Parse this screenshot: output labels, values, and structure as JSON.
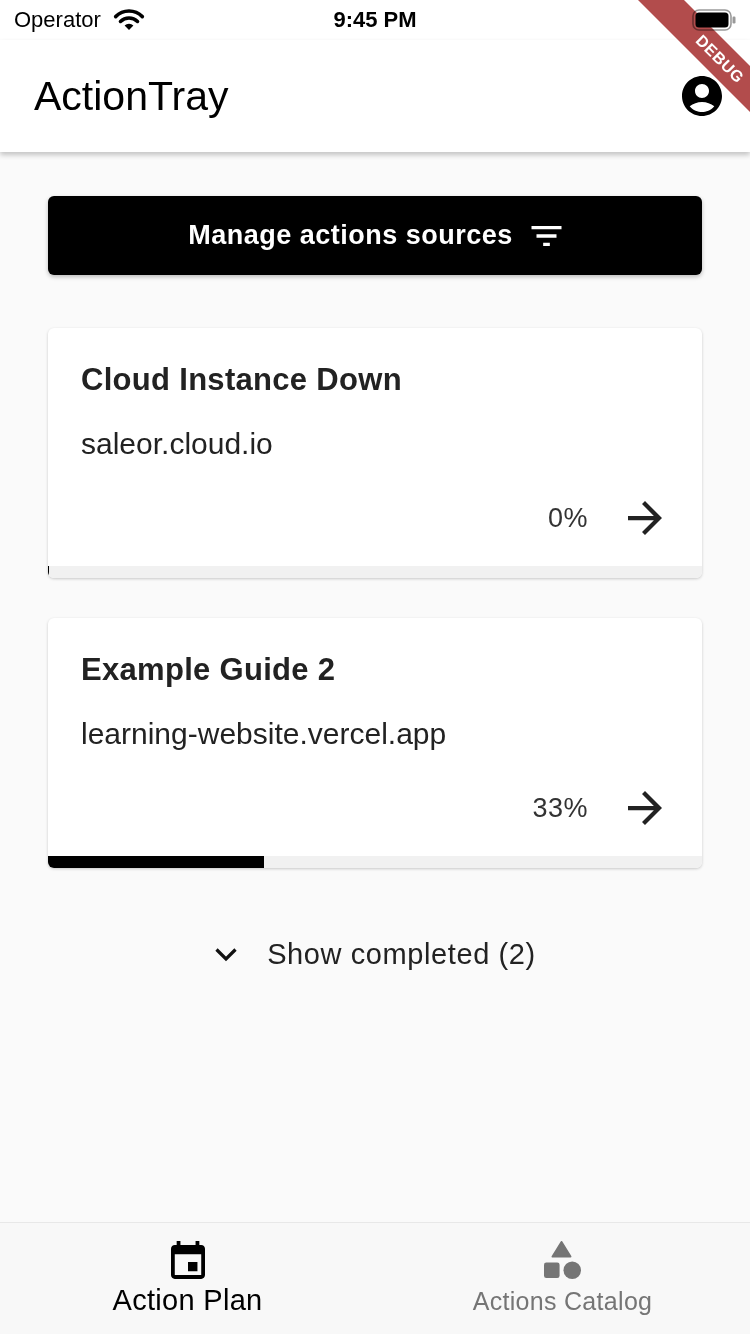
{
  "status_bar": {
    "carrier": "Operator",
    "time": "9:45 PM"
  },
  "debug_banner": {
    "label": "DEBUG"
  },
  "app_bar": {
    "title": "ActionTray"
  },
  "manage_button": {
    "label": "Manage actions sources"
  },
  "actions": [
    {
      "title": "Cloud Instance Down",
      "source": "saleor.cloud.io",
      "percent": "0%",
      "level": 0
    },
    {
      "title": "Example Guide 2",
      "source": "learning-website.vercel.app",
      "percent": "33%",
      "level": 0.33
    }
  ],
  "show_completed": {
    "label": "Show completed (2)",
    "expanded": false
  },
  "bottom_nav": [
    {
      "kind": "plan",
      "label": "Action Plan",
      "selected": true
    },
    {
      "kind": "catalog",
      "label": "Actions Catalog",
      "selected": false
    }
  ]
}
